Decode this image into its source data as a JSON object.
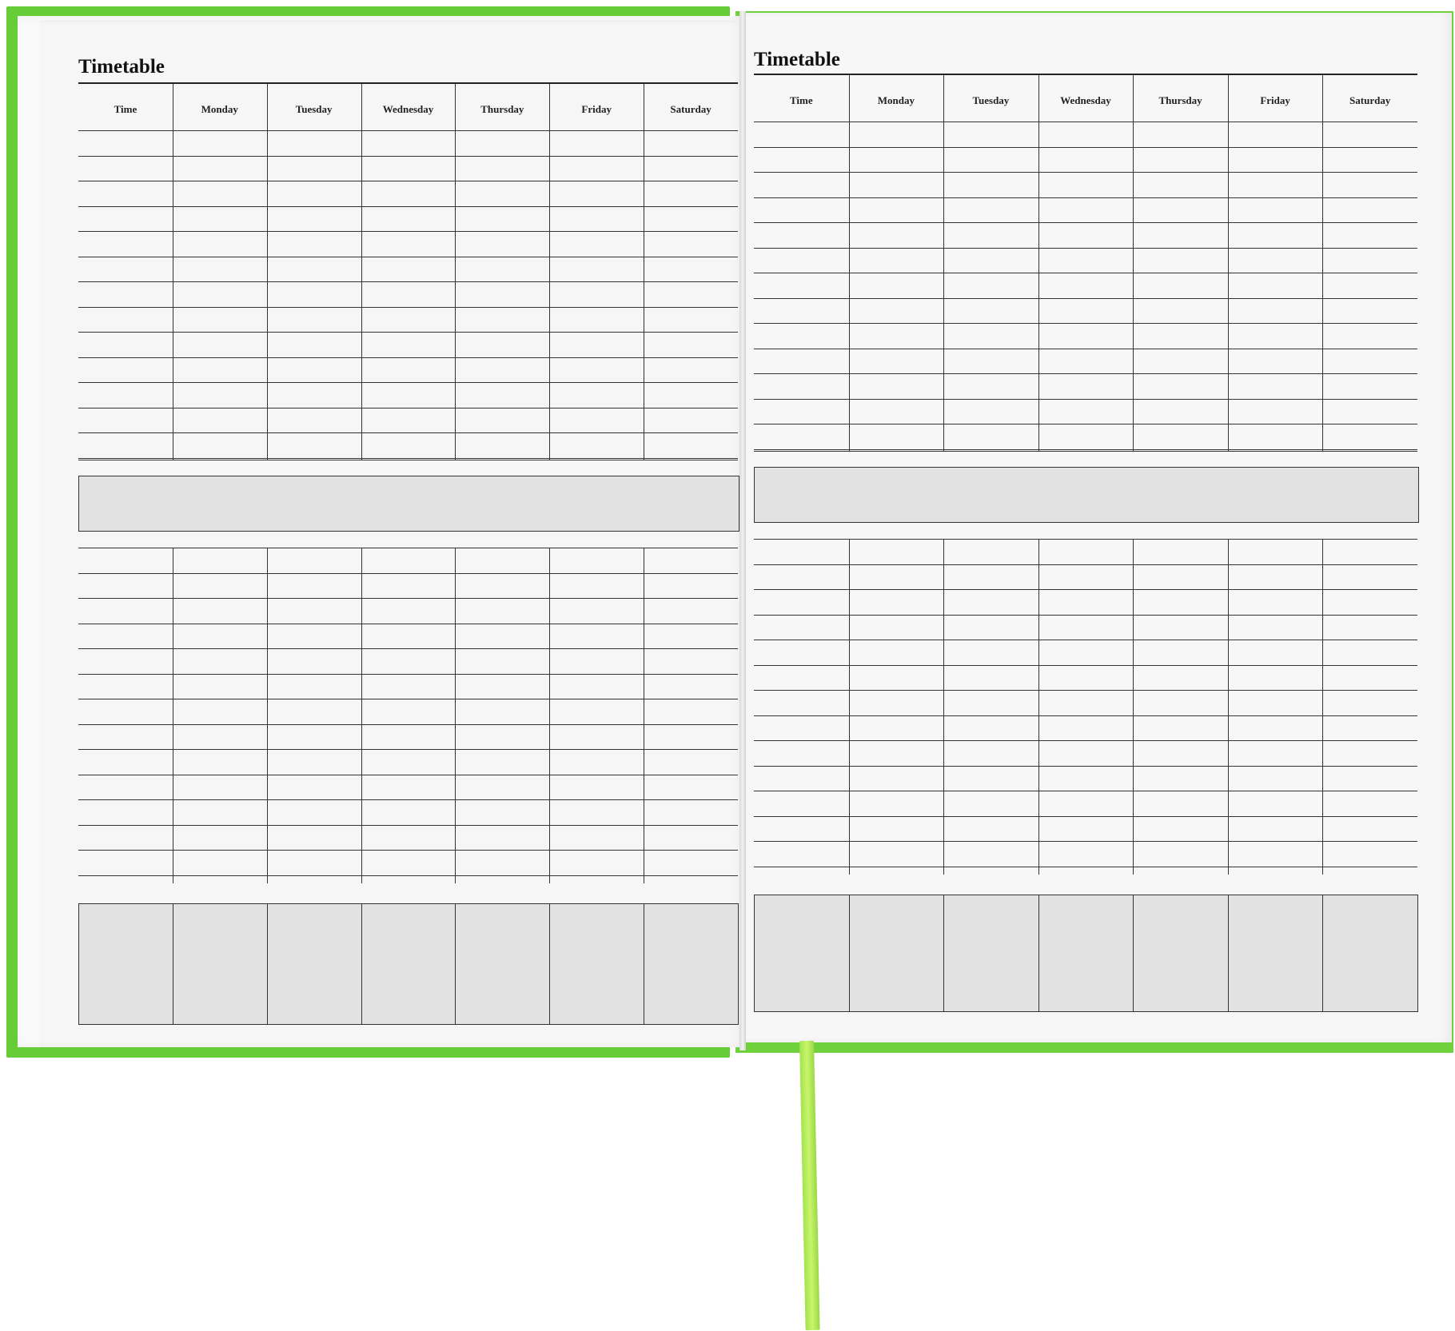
{
  "colors": {
    "cover": "#66cc38",
    "ribbon": "#b8ee5e",
    "page": "#f8f8f8"
  },
  "left_page": {
    "title": "Timetable",
    "headers": [
      "Time",
      "Monday",
      "Tuesday",
      "Wednesday",
      "Thursday",
      "Friday",
      "Saturday"
    ]
  },
  "right_page": {
    "title": "Timetable",
    "headers": [
      "Time",
      "Monday",
      "Tuesday",
      "Wednesday",
      "Thursday",
      "Friday",
      "Saturday"
    ]
  }
}
